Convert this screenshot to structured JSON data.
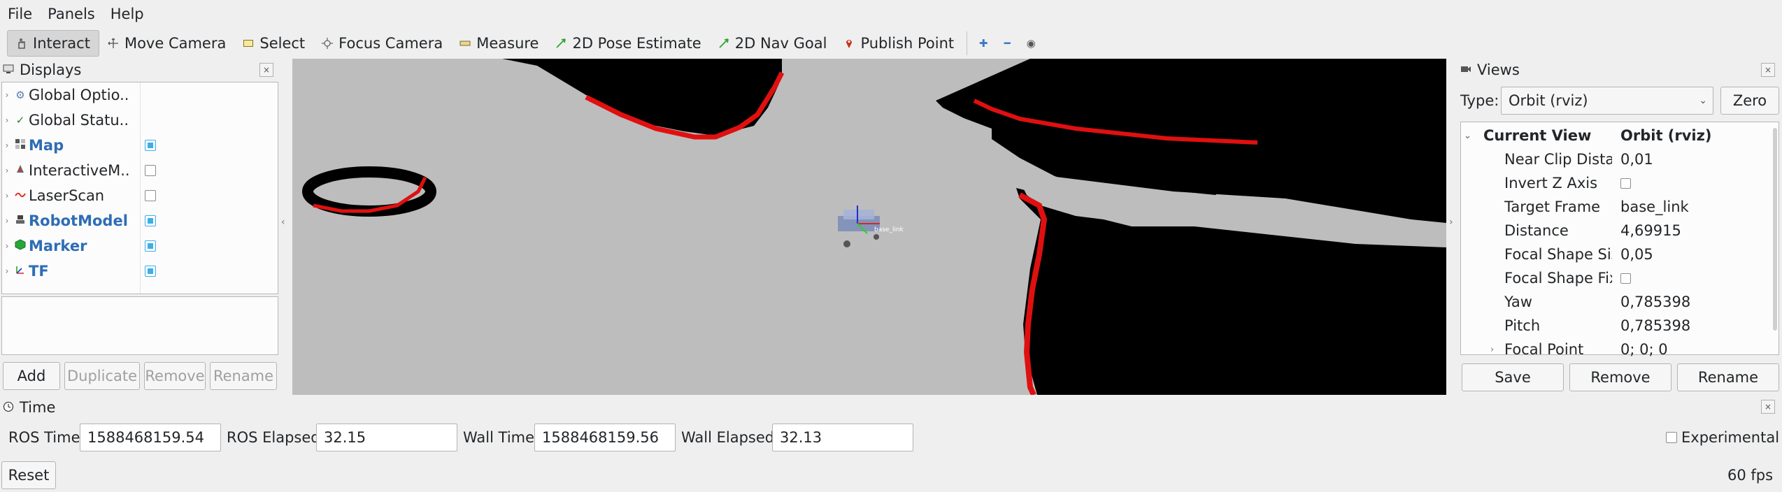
{
  "menu": [
    "File",
    "Panels",
    "Help"
  ],
  "toolbar": {
    "tools": [
      {
        "label": "Interact",
        "icon": "hand-icon",
        "active": true
      },
      {
        "label": "Move Camera",
        "icon": "move-camera-icon",
        "active": false
      },
      {
        "label": "Select",
        "icon": "select-icon",
        "active": false
      },
      {
        "label": "Focus Camera",
        "icon": "focus-icon",
        "active": false
      },
      {
        "label": "Measure",
        "icon": "ruler-icon",
        "active": false
      },
      {
        "label": "2D Pose Estimate",
        "icon": "pose-arrow-icon",
        "active": false
      },
      {
        "label": "2D Nav Goal",
        "icon": "nav-arrow-icon",
        "active": false
      },
      {
        "label": "Publish Point",
        "icon": "pin-icon",
        "active": false
      }
    ]
  },
  "displays": {
    "title": "Displays",
    "items": [
      {
        "label": "Global Optio...",
        "icon": "gear-icon",
        "checkbox": null,
        "bold": false
      },
      {
        "label": "Global Statu...",
        "icon": "checkmark-icon",
        "checkbox": null,
        "bold": false
      },
      {
        "label": "Map",
        "icon": "map-icon",
        "checkbox": true,
        "bold": true
      },
      {
        "label": "InteractiveM...",
        "icon": "interactive-marker-icon",
        "checkbox": false,
        "bold": false
      },
      {
        "label": "LaserScan",
        "icon": "laser-icon",
        "checkbox": false,
        "bold": false
      },
      {
        "label": "RobotModel",
        "icon": "robot-icon",
        "checkbox": true,
        "bold": true
      },
      {
        "label": "Marker",
        "icon": "cube-icon",
        "checkbox": true,
        "bold": true
      },
      {
        "label": "TF",
        "icon": "axes-icon",
        "checkbox": true,
        "bold": true
      }
    ],
    "buttons": {
      "add": "Add",
      "duplicate": "Duplicate",
      "remove": "Remove",
      "rename": "Rename"
    }
  },
  "viewport": {
    "robot_label": "base_link"
  },
  "views": {
    "title": "Views",
    "type_label": "Type:",
    "type_value": "Orbit (rviz)",
    "zero": "Zero",
    "header_name": "Current View",
    "header_value": "Orbit (rviz)",
    "props": [
      {
        "name": "Near Clip Dista...",
        "value": "0,01",
        "checkbox": false
      },
      {
        "name": "Invert Z Axis",
        "value": "",
        "checkbox": true
      },
      {
        "name": "Target Frame",
        "value": "base_link",
        "checkbox": false
      },
      {
        "name": "Distance",
        "value": "4,69915",
        "checkbox": false
      },
      {
        "name": "Focal Shape Size",
        "value": "0,05",
        "checkbox": false
      },
      {
        "name": "Focal Shape Fix...",
        "value": "",
        "checkbox": true
      },
      {
        "name": "Yaw",
        "value": "0,785398",
        "checkbox": false
      },
      {
        "name": "Pitch",
        "value": "0,785398",
        "checkbox": false
      },
      {
        "name": "Focal Point",
        "value": "0; 0; 0",
        "checkbox": false,
        "expandable": true
      }
    ],
    "buttons": {
      "save": "Save",
      "remove": "Remove",
      "rename": "Rename"
    }
  },
  "time": {
    "title": "Time",
    "ros_time_label": "ROS Time:",
    "ros_time": "1588468159.54",
    "ros_elapsed_label": "ROS Elapsed:",
    "ros_elapsed": "32.15",
    "wall_time_label": "Wall Time:",
    "wall_time": "1588468159.56",
    "wall_elapsed_label": "Wall Elapsed:",
    "wall_elapsed": "32.13",
    "experimental": "Experimental"
  },
  "status": {
    "reset": "Reset",
    "fps": "60 fps"
  }
}
